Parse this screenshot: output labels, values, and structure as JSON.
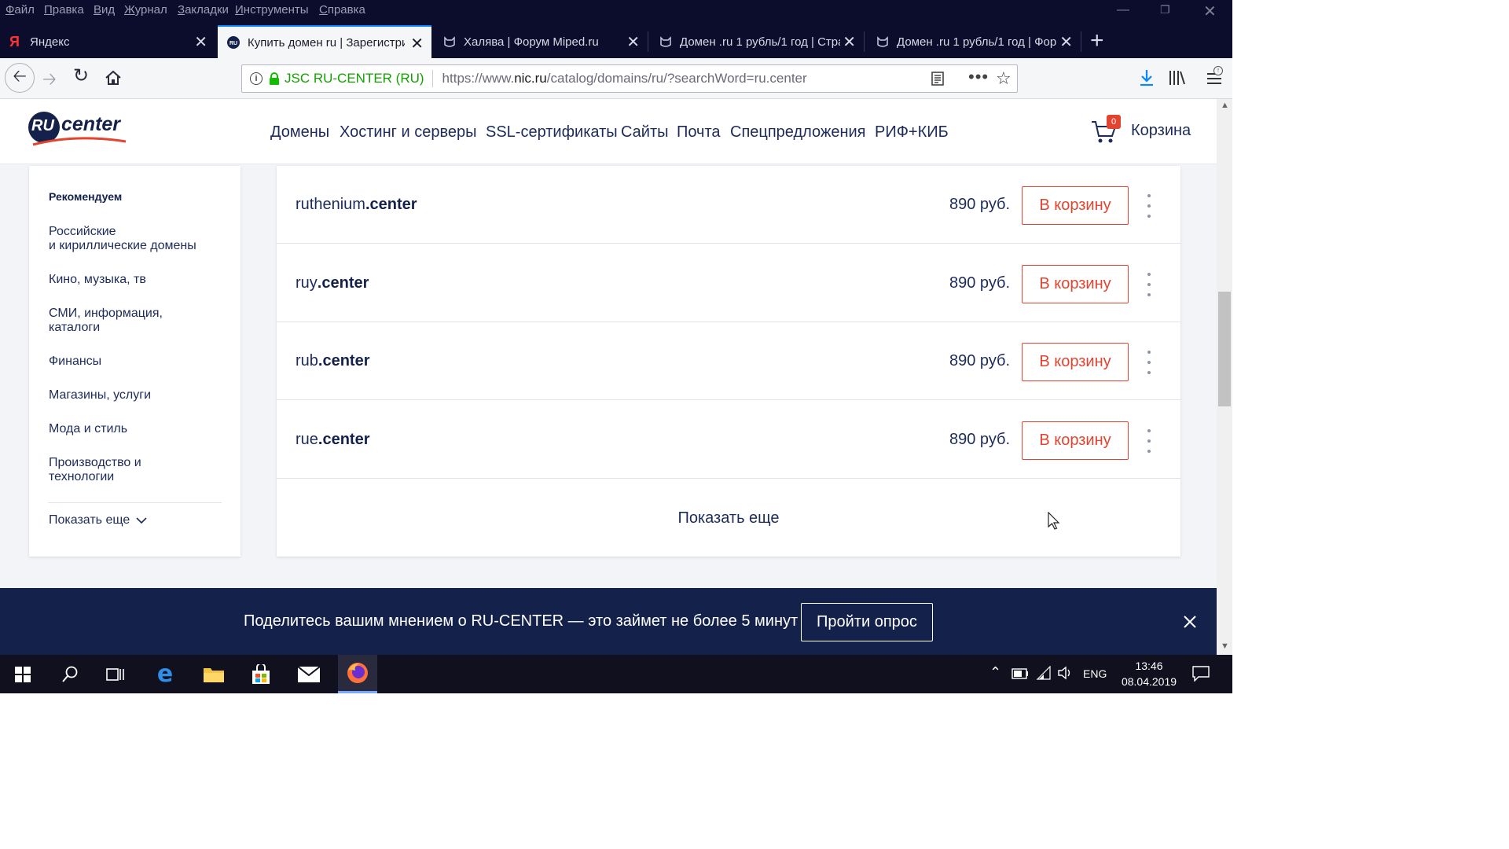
{
  "menubar": {
    "items": [
      "Файл",
      "Правка",
      "Вид",
      "Журнал",
      "Закладки",
      "Инструменты",
      "Справка"
    ]
  },
  "tabs": [
    {
      "title": "Яндекс",
      "icon": "yandex-icon"
    },
    {
      "title": "Купить домен ru | Зарегистрир",
      "icon": "ru-center-icon",
      "active": true
    },
    {
      "title": "Халява | Форум Miped.ru",
      "icon": "miped-icon"
    },
    {
      "title": "Домен .ru 1 рубль/1 год | Стра",
      "icon": "miped-icon"
    },
    {
      "title": "Домен .ru 1 рубль/1 год | Фор",
      "icon": "miped-icon"
    }
  ],
  "urlbar": {
    "identity": "JSC RU-CENTER (RU)",
    "url_prefix": "https://www.",
    "url_domain": "nic.ru",
    "url_path": "/catalog/domains/ru/?searchWord=ru.center"
  },
  "site": {
    "logo_ru": "RU",
    "logo_center": "center",
    "nav": [
      "Домены",
      "Хостинг и серверы",
      "SSL-сертификаты",
      "Сайты",
      "Почта",
      "Спецпредложения",
      "РИФ+КИБ"
    ],
    "cart_label": "Корзина",
    "cart_count": "0"
  },
  "sidebar": {
    "heading": "Рекомендуем",
    "items": [
      {
        "l1": "Российские",
        "l2": "и кириллические домены"
      },
      {
        "l1": "Кино, музыка, тв",
        "l2": ""
      },
      {
        "l1": "СМИ, информация,",
        "l2": "каталоги"
      },
      {
        "l1": "Финансы",
        "l2": ""
      },
      {
        "l1": "Магазины, услуги",
        "l2": ""
      },
      {
        "l1": "Мода и стиль",
        "l2": ""
      },
      {
        "l1": "Производство и",
        "l2": "технологии"
      }
    ],
    "show_more": "Показать еще"
  },
  "results": [
    {
      "name": "ruthenium",
      "tld": ".center",
      "price": "890 руб.",
      "button": "В корзину"
    },
    {
      "name": "ruy",
      "tld": ".center",
      "price": "890 руб.",
      "button": "В корзину"
    },
    {
      "name": "rub",
      "tld": ".center",
      "price": "890 руб.",
      "button": "В корзину"
    },
    {
      "name": "rue",
      "tld": ".center",
      "price": "890 руб.",
      "button": "В корзину"
    }
  ],
  "show_more_results": "Показать еще",
  "banner": {
    "text": "Поделитесь вашим мнением о RU-CENTER — это займет не более 5 минут",
    "button": "Пройти опрос"
  },
  "taskbar": {
    "lang": "ENG",
    "time": "13:46",
    "date": "08.04.2019"
  },
  "colors": {
    "brand_navy": "#14214a",
    "accent_red": "#e2442f",
    "secure_green": "#12bc00"
  }
}
